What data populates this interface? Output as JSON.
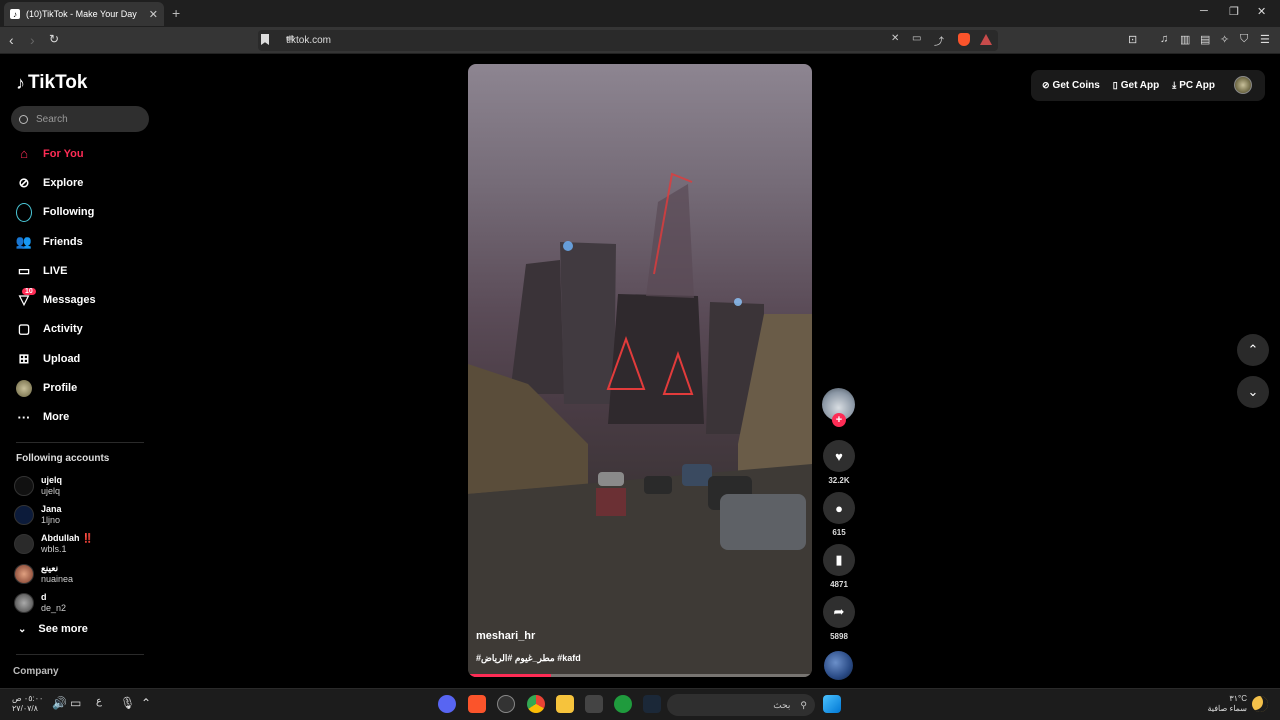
{
  "browser": {
    "tab_title": "(10)TikTok - Make Your Day",
    "tab_close": "✕",
    "new_tab": "+",
    "url": "tiktok.com"
  },
  "sidebar": {
    "logo_text": "TikTok",
    "search_placeholder": "Search",
    "nav": [
      {
        "label": "For You",
        "icon": "home-icon",
        "active": true
      },
      {
        "label": "Explore",
        "icon": "compass-icon"
      },
      {
        "label": "Following",
        "icon": "following-icon"
      },
      {
        "label": "Friends",
        "icon": "friends-icon"
      },
      {
        "label": "LIVE",
        "icon": "live-icon"
      },
      {
        "label": "Messages",
        "icon": "messages-icon",
        "badge": "10"
      },
      {
        "label": "Activity",
        "icon": "activity-icon"
      },
      {
        "label": "Upload",
        "icon": "upload-icon"
      },
      {
        "label": "Profile",
        "icon": "profile-icon"
      },
      {
        "label": "More",
        "icon": "more-icon"
      }
    ],
    "following_title": "Following accounts",
    "accounts": [
      {
        "name": "ujelq",
        "handle": "ujelq"
      },
      {
        "name": "Jana",
        "handle": "1ljno"
      },
      {
        "name": "Abdullah ‼️",
        "handle": "wbls.1"
      },
      {
        "name": "نعينع",
        "handle": "nuainea"
      },
      {
        "name": "d",
        "handle": "de_n2"
      }
    ],
    "see_more": "See more",
    "company": "Company"
  },
  "video": {
    "username": "meshari_hr",
    "caption": "#مطر_غيوم #الرياض #kafd",
    "progress": 0.24
  },
  "actions": {
    "likes": "32.2K",
    "comments": "615",
    "saves": "4871",
    "shares": "5898"
  },
  "top_right": {
    "get_coins": "Get Coins",
    "get_app": "Get App",
    "pc_app": "PC App"
  },
  "taskbar": {
    "time": "٠٥:٠٠ ص",
    "date": "٢٧/٠٧/٨",
    "lang": "ع",
    "search_text": "بحث",
    "temp": "٣١°C",
    "weather": "سماء صافية"
  },
  "colors": {
    "accent": "#fe2c55",
    "background": "#000000"
  }
}
